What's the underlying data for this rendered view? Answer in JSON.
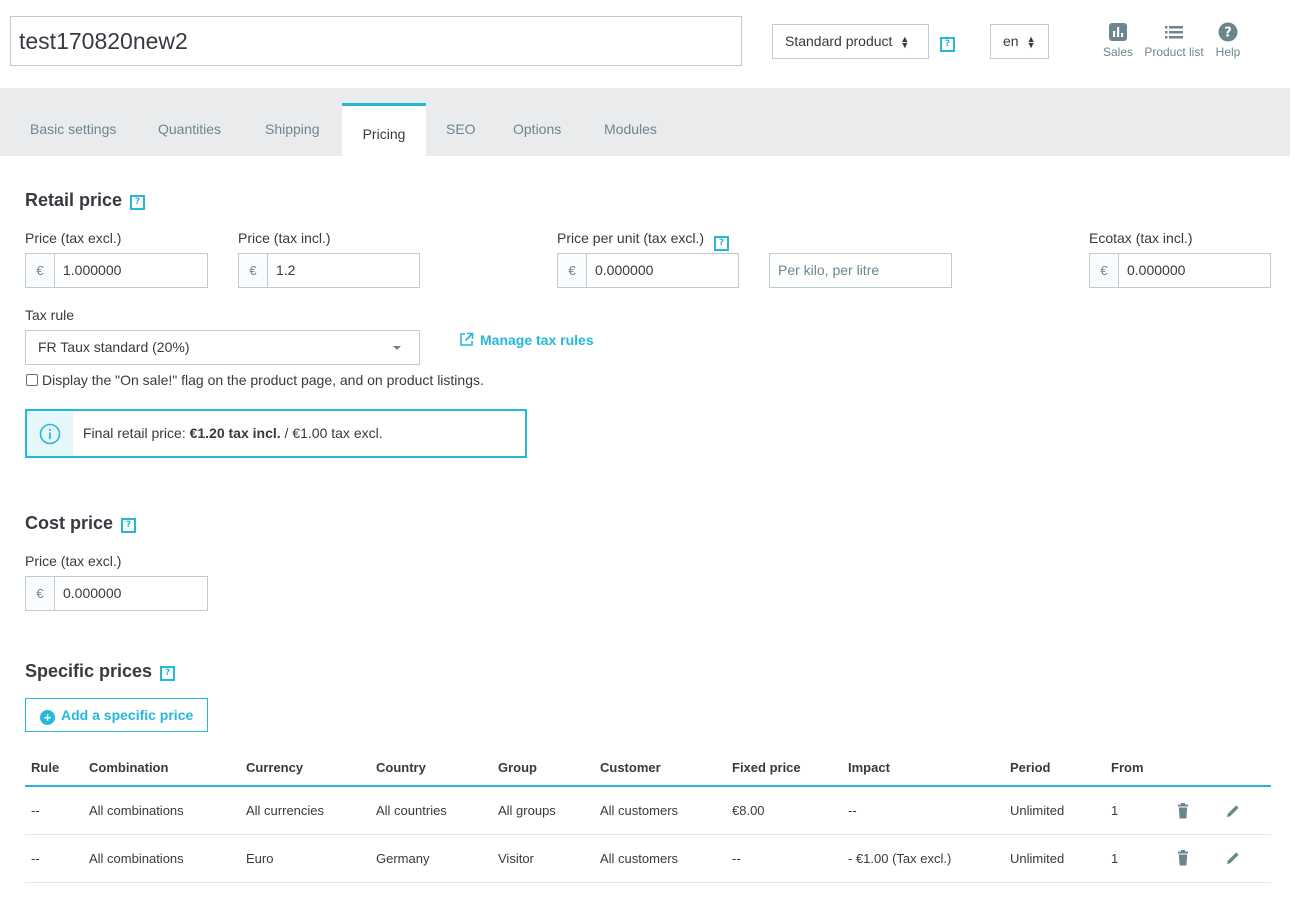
{
  "header": {
    "product_name": "test170820new2",
    "product_type": "Standard product",
    "help_badge": "?",
    "language": "en",
    "buttons": [
      {
        "label": "Sales",
        "icon": "bar-chart-icon"
      },
      {
        "label": "Product list",
        "icon": "list-icon"
      },
      {
        "label": "Help",
        "icon": "help-icon"
      }
    ]
  },
  "tabs": [
    "Basic settings",
    "Quantities",
    "Shipping",
    "Pricing",
    "SEO",
    "Options",
    "Modules"
  ],
  "active_tab": "Pricing",
  "retail": {
    "title": "Retail price",
    "help": "?",
    "price_excl_label": "Price (tax excl.)",
    "price_excl_value": "1.000000",
    "price_incl_label": "Price (tax incl.)",
    "price_incl_value": "1.2",
    "unit_label": "Price per unit (tax excl.)",
    "unit_value": "0.000000",
    "unit_placeholder": "Per kilo, per litre",
    "ecotax_label": "Ecotax (tax incl.)",
    "ecotax_value": "0.000000",
    "currency": "€",
    "tax_rule_label": "Tax rule",
    "tax_rule_value": "FR Taux standard (20%)",
    "manage_tax_link": "Manage tax rules",
    "on_sale_text": "Display the \"On sale!\" flag on the product page, and on product listings.",
    "final_prefix": "Final retail price: ",
    "final_incl": "€1.20 tax incl.",
    "final_excl": " / €1.00 tax excl."
  },
  "cost": {
    "title": "Cost price",
    "help": "?",
    "label": "Price (tax excl.)",
    "value": "0.000000",
    "currency": "€"
  },
  "specific": {
    "title": "Specific prices",
    "help": "?",
    "add_button": "Add a specific price",
    "columns": [
      "Rule",
      "Combination",
      "Currency",
      "Country",
      "Group",
      "Customer",
      "Fixed price",
      "Impact",
      "Period",
      "From"
    ],
    "rows": [
      [
        "--",
        "All combinations",
        "All currencies",
        "All countries",
        "All groups",
        "All customers",
        "€8.00",
        "--",
        "Unlimited",
        "1"
      ],
      [
        "--",
        "All combinations",
        "Euro",
        "Germany",
        "Visitor",
        "All customers",
        "--",
        "- €1.00 (Tax excl.)",
        "Unlimited",
        "1"
      ]
    ]
  },
  "colors": {
    "accent": "#25b9d7",
    "text": "#363a41",
    "muted": "#6c868e",
    "tabbar": "#eaebec",
    "border": "#bbcdd2"
  }
}
